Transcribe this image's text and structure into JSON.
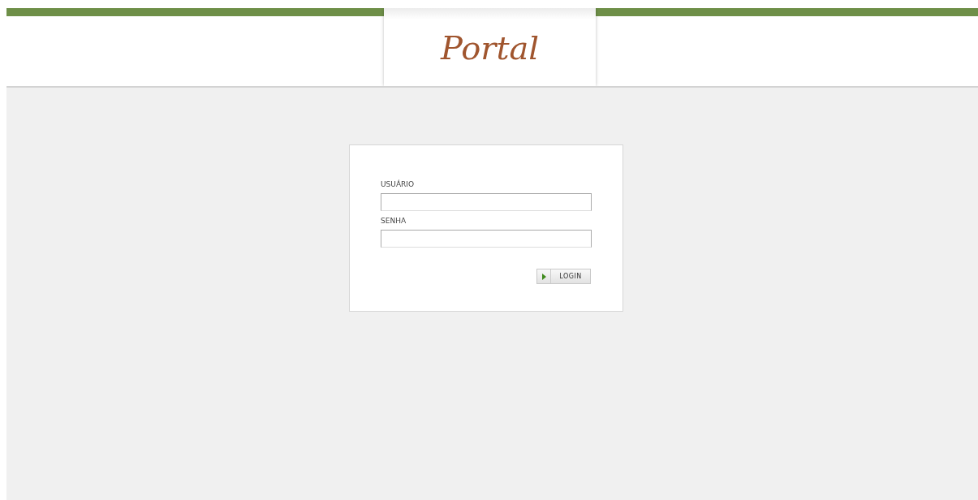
{
  "header": {
    "title": "Portal"
  },
  "login_form": {
    "fields": [
      {
        "label": "USUÁRIO"
      },
      {
        "label": "SENHA"
      }
    ],
    "button": "LOGIN"
  }
}
